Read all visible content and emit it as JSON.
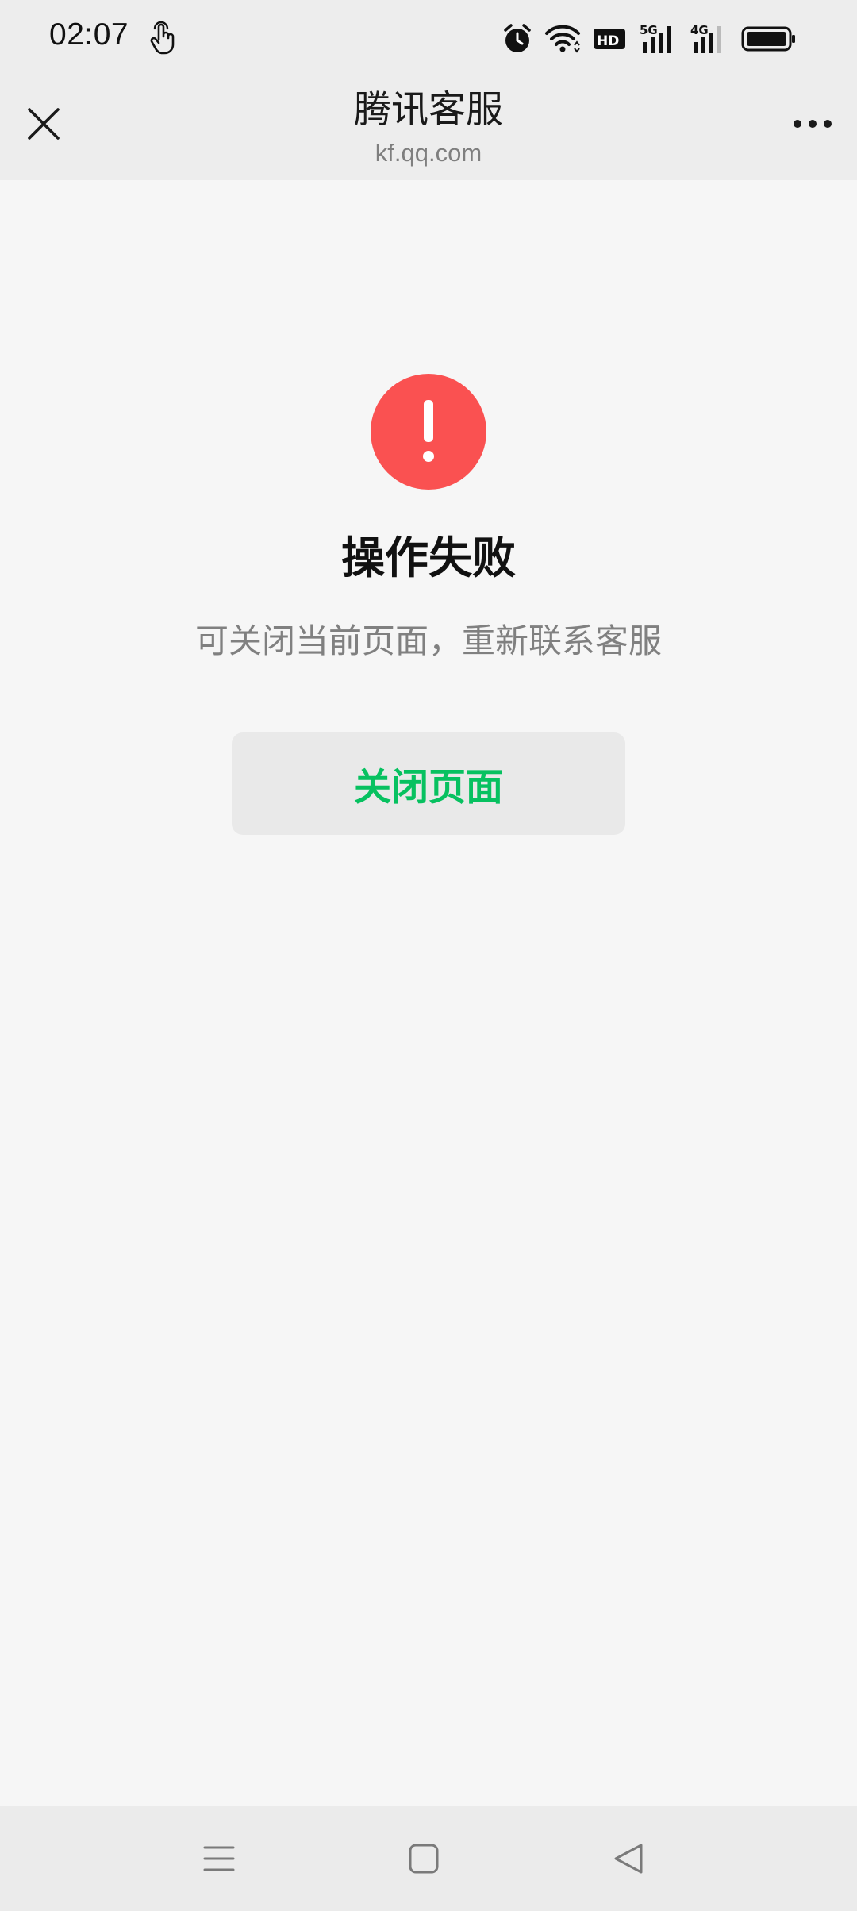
{
  "status_bar": {
    "time": "02:07",
    "icons": [
      "touch-icon",
      "alarm-icon",
      "wifi-icon",
      "hd-icon",
      "signal-5g-icon",
      "signal-4g-icon",
      "battery-icon"
    ],
    "hd_label": "HD",
    "net1_label": "5G",
    "net2_label": "4G"
  },
  "title_bar": {
    "title": "腾讯客服",
    "subtitle": "kf.qq.com",
    "close_icon": "close-icon",
    "more_icon": "more-icon"
  },
  "content": {
    "error_icon": "exclamation-icon",
    "error_color": "#fa5151",
    "title": "操作失败",
    "description": "可关闭当前页面，重新联系客服",
    "button_label": "关闭页面",
    "button_color": "#07c160"
  },
  "nav_bar": {
    "icons": [
      "menu-icon",
      "home-icon",
      "back-icon"
    ]
  }
}
